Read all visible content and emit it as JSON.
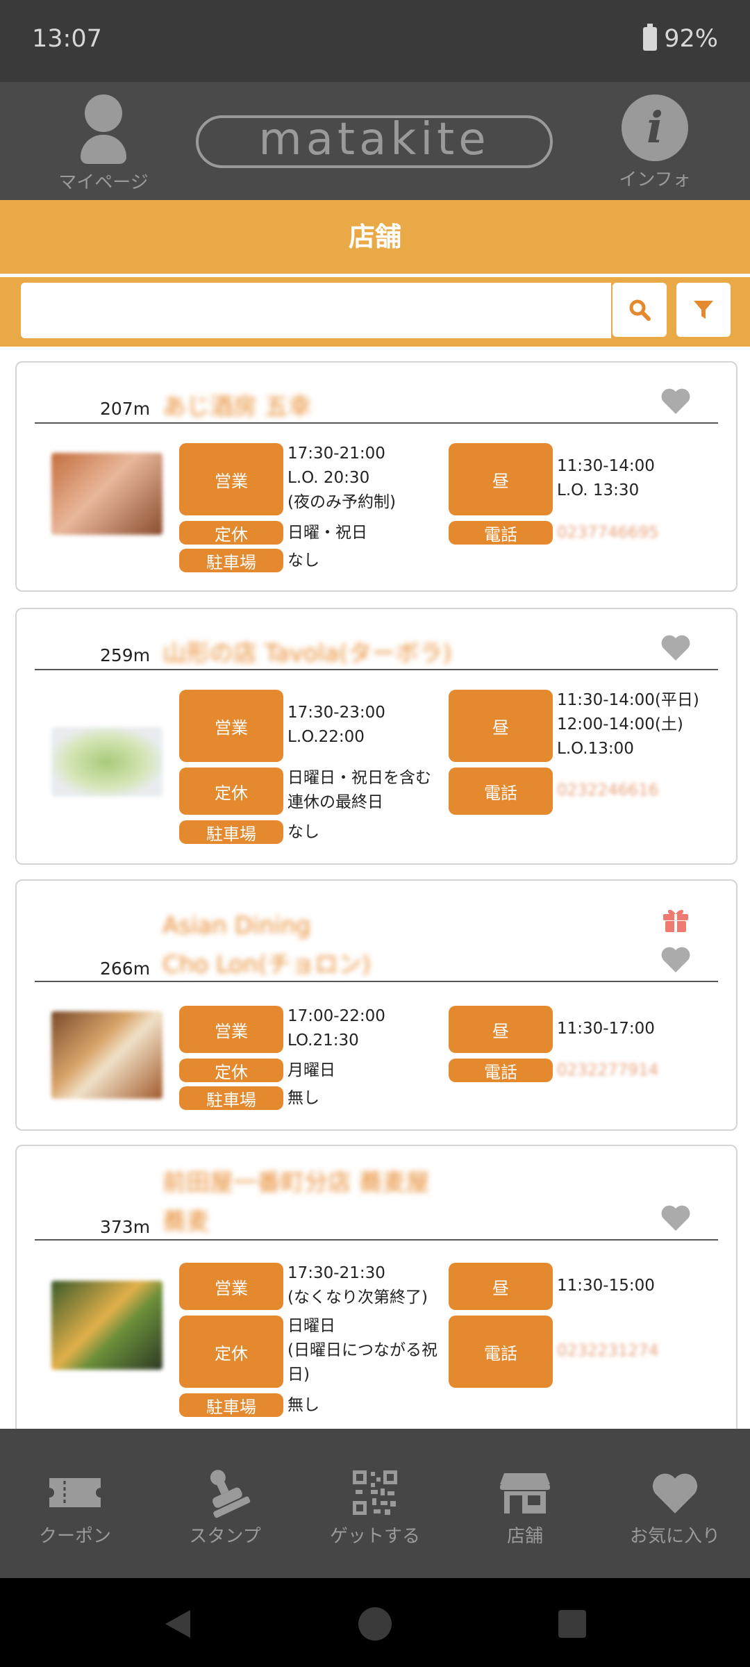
{
  "status": {
    "time": "13:07",
    "battery": "92%"
  },
  "header": {
    "mypage": "マイページ",
    "logo": "matakite",
    "info": "インフォ"
  },
  "page_title": "店舗",
  "search": {
    "placeholder": ""
  },
  "colors": {
    "accent": "#e9a947",
    "tag": "#e5892f",
    "dark": "#4a4a4a"
  },
  "stores": [
    {
      "name1": "あじ酒房 五幸",
      "name2": "",
      "distance": "207m",
      "gift": false,
      "open_label": "営業",
      "open": "17:30-21:00\nL.O. 20:30\n(夜のみ予約制)",
      "lunch_label": "昼",
      "lunch": "11:30-14:00\nL.O. 13:30",
      "closed_label": "定休",
      "closed": "日曜・祝日",
      "phone_label": "電話",
      "phone": "0237746695",
      "parking_label": "駐車場",
      "parking": "なし"
    },
    {
      "name1": "山形の店 Tavola(ターボラ)",
      "name2": "",
      "distance": "259m",
      "gift": false,
      "open_label": "営業",
      "open": "17:30-23:00\nL.O.22:00",
      "lunch_label": "昼",
      "lunch": "11:30-14:00(平日)\n12:00-14:00(土)\nL.O.13:00",
      "closed_label": "定休",
      "closed": "日曜日・祝日を含む\n連休の最終日",
      "phone_label": "電話",
      "phone": "0232246616",
      "parking_label": "駐車場",
      "parking": "なし"
    },
    {
      "name1": "Asian Dining",
      "name2": "Cho Lon(チョロン)",
      "distance": "266m",
      "gift": true,
      "open_label": "営業",
      "open": "17:00-22:00\nLO.21:30",
      "lunch_label": "昼",
      "lunch": "11:30-17:00",
      "closed_label": "定休",
      "closed": "月曜日",
      "phone_label": "電話",
      "phone": "0232277914",
      "parking_label": "駐車場",
      "parking": "無し"
    },
    {
      "name1": "前田屋一番町分店 蕎麦屋",
      "name2": "蕎麦",
      "distance": "373m",
      "gift": false,
      "open_label": "営業",
      "open": "17:30-21:30\n(なくなり次第終了)",
      "lunch_label": "昼",
      "lunch": "11:30-15:00",
      "closed_label": "定休",
      "closed": "日曜日\n(日曜日につながる祝\n日)",
      "phone_label": "電話",
      "phone": "0232231274",
      "parking_label": "駐車場",
      "parking": "無し"
    }
  ],
  "tabs": [
    {
      "label": "クーポン",
      "icon": "coupon-icon"
    },
    {
      "label": "スタンプ",
      "icon": "stamp-icon"
    },
    {
      "label": "ゲットする",
      "icon": "qr-icon"
    },
    {
      "label": "店舗",
      "icon": "store-icon"
    },
    {
      "label": "お気に入り",
      "icon": "heart-icon"
    }
  ]
}
